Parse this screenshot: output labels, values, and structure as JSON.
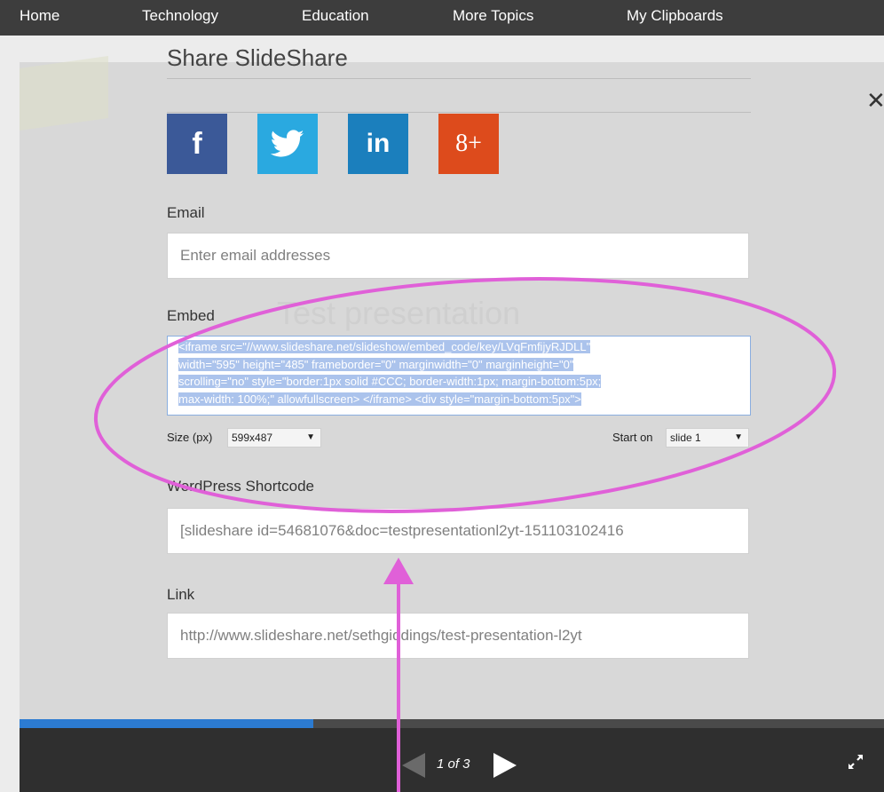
{
  "nav": {
    "items": [
      "Home",
      "Technology",
      "Education",
      "More Topics",
      "My Clipboards"
    ]
  },
  "modal": {
    "heading": "Share SlideShare",
    "close_icon": "close-icon",
    "close_glyph": "✕",
    "social": {
      "facebook": {
        "icon": "facebook-icon",
        "glyph": "f",
        "color": "#3b5998"
      },
      "twitter": {
        "icon": "twitter-icon",
        "color": "#2aa9e0"
      },
      "linkedin": {
        "icon": "linkedin-icon",
        "glyph": "in",
        "color": "#1b7fbd"
      },
      "googleplus": {
        "icon": "google-plus-icon",
        "glyph": "8+",
        "color": "#dd4b1c"
      }
    },
    "email": {
      "label": "Email",
      "placeholder": "Enter email addresses"
    },
    "embed": {
      "label": "Embed",
      "lines": [
        "<iframe src=\"//www.slideshare.net/slideshow/embed_code/key/LVqFmfijyRJDLL\"",
        "width=\"595\" height=\"485\" frameborder=\"0\" marginwidth=\"0\" marginheight=\"0\"",
        "scrolling=\"no\" style=\"border:1px solid #CCC; border-width:1px; margin-bottom:5px;",
        "max-width: 100%;\" allowfullscreen> </iframe> <div style=\"margin-bottom:5px\">"
      ],
      "size_label": "Size (px)",
      "size_value": "599x487",
      "start_label": "Start on",
      "start_value": "slide 1",
      "dropdown_glyph": "▼"
    },
    "wordpress": {
      "label": "WordPress Shortcode",
      "value": "[slideshare id=54681076&doc=testpresentationl2yt-151103102416"
    },
    "link": {
      "label": "Link",
      "value": "http://www.slideshare.net/sethgiddings/test-presentation-l2yt"
    }
  },
  "background": {
    "ghost_title": "Test presentation"
  },
  "player": {
    "page_counter": "1 of 3",
    "progress_fraction": 0.34,
    "progress_color": "#2c7bd1"
  },
  "annotation": {
    "color": "#e060d8"
  }
}
